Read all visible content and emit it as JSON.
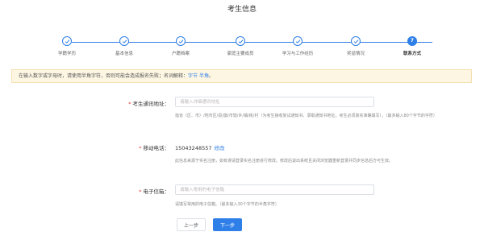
{
  "page": {
    "title": "考生信息"
  },
  "colors": {
    "accent": "#2f7fe8",
    "required": "#e53935",
    "notice_bg": "#fdf6e3"
  },
  "stepper": {
    "current": 7,
    "steps": [
      {
        "label": "学籍学历",
        "status": "done",
        "icon": "check-icon"
      },
      {
        "label": "基本信息",
        "status": "done",
        "icon": "check-icon"
      },
      {
        "label": "户籍档案",
        "status": "done",
        "icon": "check-icon"
      },
      {
        "label": "家庭主要成员",
        "status": "done",
        "icon": "check-icon"
      },
      {
        "label": "学习与工作经历",
        "status": "done",
        "icon": "check-icon"
      },
      {
        "label": "奖惩情况",
        "status": "done",
        "icon": "check-icon"
      },
      {
        "label": "联系方式",
        "status": "active",
        "number": "7"
      }
    ]
  },
  "notice": {
    "text": "在输入数字或字母时，请使用半角字符，否则可能会造成报名失败；名词解释：",
    "links": [
      "字节",
      "半角"
    ],
    "end": "。"
  },
  "form": {
    "address": {
      "label": "考生通讯地址：",
      "placeholder": "请输入详细通讯地址",
      "value": "",
      "hint": "指省（区、市）/地市区/县/旗/市辖/乡/镇/街/村（为考生接收复试通知书、录取通知书地址，考生必须真实准确填写），（最多输入80个字节的字符）"
    },
    "phone": {
      "label": "移动电话：",
      "value": "15043248557",
      "modify": "修改",
      "hint": "此信息来源于实名注册，如有误请登录实名注册进行修改。修改后退出系统且关闭浏览器重新登录并同步信息后方可生效。"
    },
    "email": {
      "label": "电子信箱：",
      "placeholder": "请输入常用的电子信箱",
      "value": "",
      "hint": "请填写常用的电子信箱。（最多输入30个字节的半角字符）"
    }
  },
  "buttons": {
    "prev": "上一步",
    "next": "下一步"
  }
}
